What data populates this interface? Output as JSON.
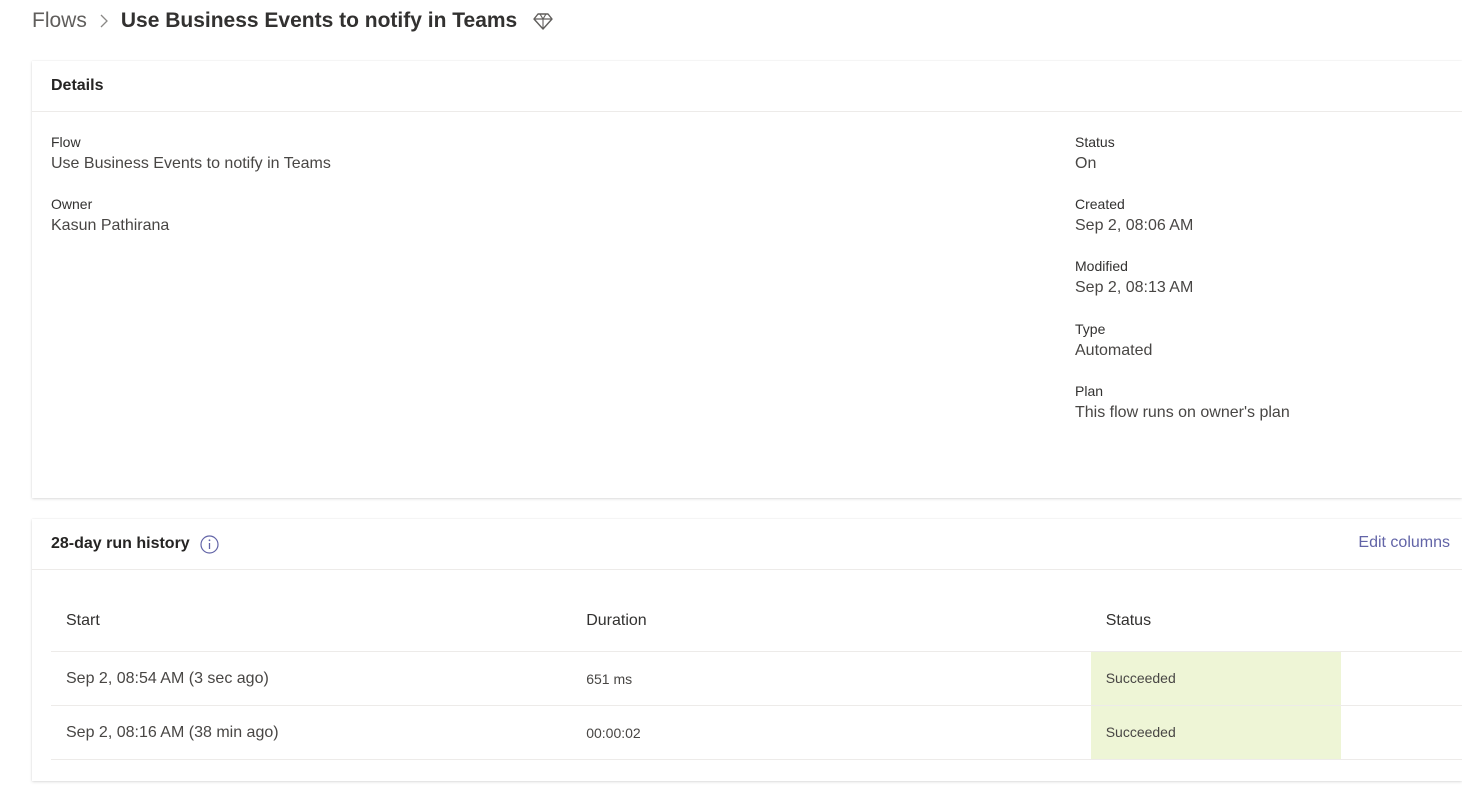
{
  "breadcrumb": {
    "root": "Flows",
    "current": "Use Business Events to notify in Teams",
    "premium_icon": "diamond-premium-icon"
  },
  "details": {
    "title": "Details",
    "flow_label": "Flow",
    "flow_value": "Use Business Events to notify in Teams",
    "owner_label": "Owner",
    "owner_value": "Kasun Pathirana",
    "status_label": "Status",
    "status_value": "On",
    "created_label": "Created",
    "created_value": "Sep 2, 08:06 AM",
    "modified_label": "Modified",
    "modified_value": "Sep 2, 08:13 AM",
    "type_label": "Type",
    "type_value": "Automated",
    "plan_label": "Plan",
    "plan_value": "This flow runs on owner's plan"
  },
  "history": {
    "title": "28-day run history",
    "info_icon": "info-icon",
    "edit_columns": "Edit columns",
    "columns": {
      "start": "Start",
      "duration": "Duration",
      "status": "Status"
    },
    "rows": [
      {
        "start": "Sep 2, 08:54 AM (3 sec ago)",
        "duration": "651 ms",
        "status": "Succeeded"
      },
      {
        "start": "Sep 2, 08:16 AM (38 min ago)",
        "duration": "00:00:02",
        "status": "Succeeded"
      }
    ]
  },
  "colors": {
    "accent": "#6264a7",
    "succeeded_bg": "#eef5d6"
  }
}
